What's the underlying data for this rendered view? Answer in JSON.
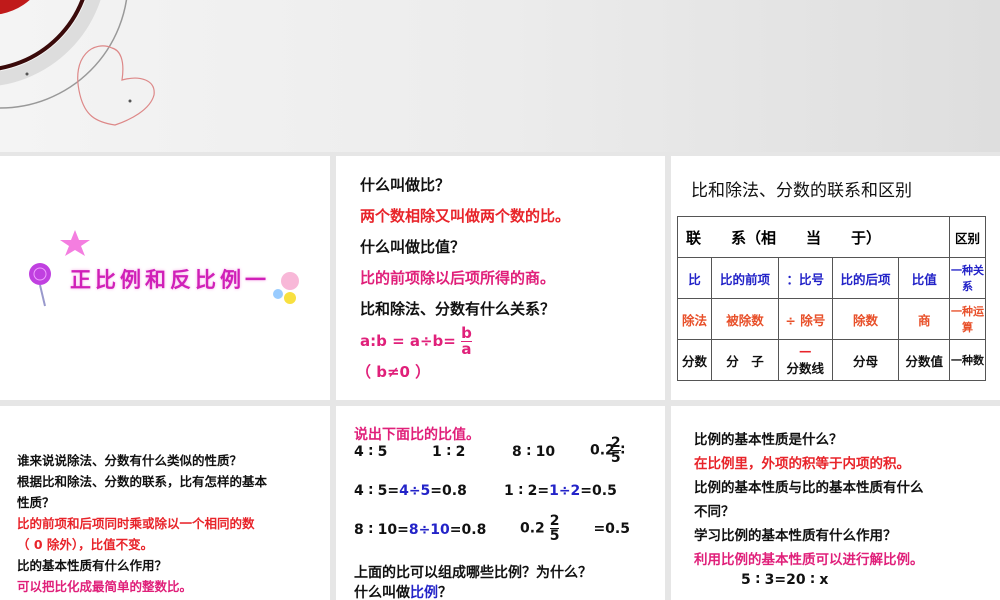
{
  "slide1": {
    "title": "正比例和反比例一"
  },
  "slide2": {
    "lines": [
      "什么叫做比？",
      "两个数相除又叫做两个数的比。",
      "什么叫做比值？",
      "比的前项除以后项所得的商。",
      "比和除法、分数有什么关系？"
    ],
    "formula_left": "a:b = a÷b=",
    "formula_num": "b",
    "formula_den": "a",
    "condition": "（ b≠0 ）"
  },
  "slide3": {
    "title": "比和除法、分数的联系和区别",
    "header": [
      "联　　系（相　　当　　于）",
      "区别"
    ],
    "rows": [
      [
        "比",
        "比的前项",
        "：比号",
        "比的后项",
        "比值",
        "一种关系"
      ],
      [
        "除法",
        "被除数",
        "÷ 除号",
        "除数",
        "商",
        "一种运算"
      ],
      [
        "分数",
        "分　子",
        "—",
        "分数线",
        "分母",
        "分数值",
        "一种数"
      ]
    ]
  },
  "slide4": {
    "lines": [
      "谁来说说除法、分数有什么类似的性质？",
      "根据比和除法、分数的联系，比有怎样的基本",
      "性质？",
      "比的前项和后项同时乘或除以一个相同的数",
      "（ 0 除外），比值不变。",
      "比的基本性质有什么作用？",
      "可以把比化成最简单的整数比。"
    ]
  },
  "slide5": {
    "heading": "说出下面比的比值。",
    "ratios": [
      "4 ∶ 5",
      "1 ∶ 2",
      "8 ∶ 10",
      "0.2"
    ],
    "frac_num": "2",
    "frac_den": "5",
    "colon": "∶",
    "eq1a": "4 ∶ 5=",
    "eq1b": "4÷5",
    "eq1c": "=0.8",
    "eq2a": "1 ∶ 2=",
    "eq2b": "1÷2",
    "eq2c": "=0.5",
    "eq3a": "8 ∶ 10=",
    "eq3b": "8÷10",
    "eq3c": "=0.8",
    "eq4a": "0.2",
    "eq4c": "=0.5",
    "q1": "上面的比可以组成哪些比例？为什么？",
    "q2a": "什么叫做",
    "q2b": "比例",
    "q2c": "？"
  },
  "slide6": {
    "lines": [
      "比例的基本性质是什么？",
      "在比例里，外项的积等于内项的积。",
      "比例的基本性质与比的基本性质有什么",
      "不同？",
      "学习比例的基本性质有什么作用？",
      "利用比例的基本性质可以进行解比例。"
    ],
    "equation": "5 ∶ 3=20 ∶ x"
  }
}
